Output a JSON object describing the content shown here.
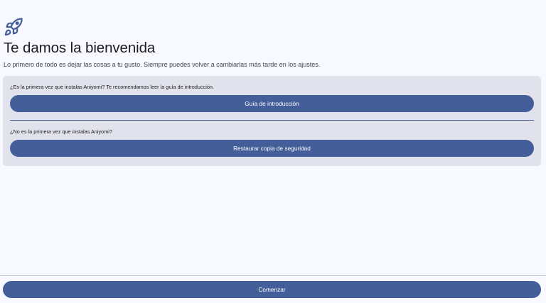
{
  "onboarding": {
    "icon": "rocket-icon",
    "title": "Te damos la bienvenida",
    "subtitle": "Lo primero de todo es dejar las cosas a tu gusto. Siempre puedes volver a cambiarlas más tarde en los ajustes."
  },
  "card": {
    "first_time_text": "¿Es la primera vez que instalas Aniyomi? Te recomendamos leer la guía de introducción.",
    "guide_button": "Guía de introducción",
    "returning_text": "¿No es la primera vez que instalas Aniyomi?",
    "restore_button": "Restaurar copia de seguridad"
  },
  "footer": {
    "start_button": "Comenzar"
  },
  "colors": {
    "primary": "#445e9a",
    "background": "#f8f9ff",
    "card": "#e2e2ec"
  }
}
